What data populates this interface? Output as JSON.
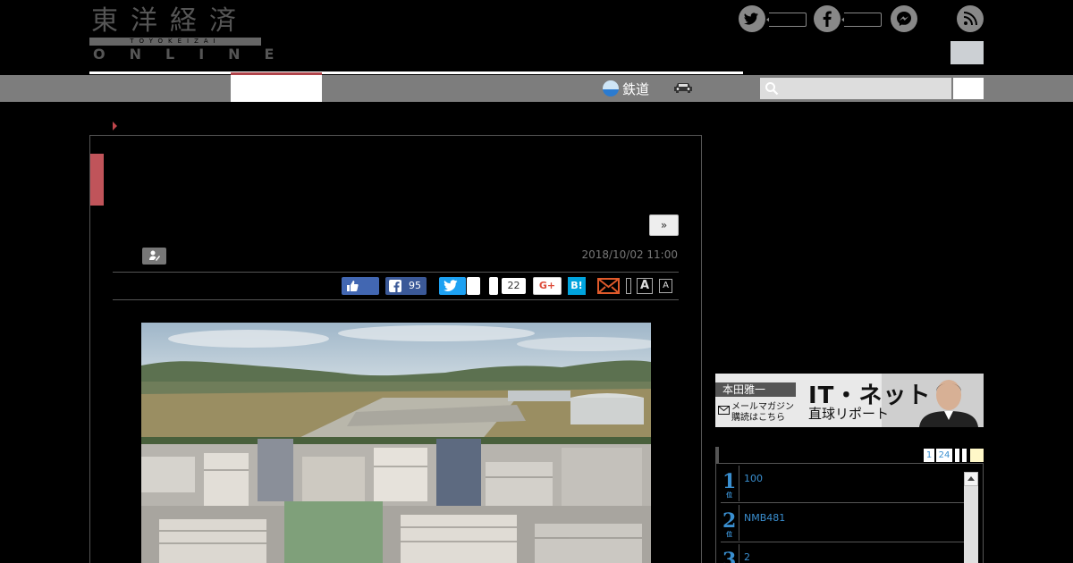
{
  "header": {
    "logo_kanji": "東洋経済",
    "logo_band": "TOYOKEIZAI",
    "logo_online": "ONLINE"
  },
  "nav": {
    "rail_label": "鉄道"
  },
  "search": {
    "placeholder": ""
  },
  "article": {
    "next_label": "»",
    "date": "2018/10/02 11:00"
  },
  "share": {
    "facebook_count": "95",
    "pocket_count": "22",
    "gplus_label": "G+",
    "hatena_label": "B!",
    "font_large_label": "A",
    "font_small_label": "A"
  },
  "banner": {
    "author": "本田雅一",
    "title": "IT・ネット",
    "subtitle": "直球リポート",
    "mail_line1": "メールマガジン",
    "mail_line2": "購読はこちら"
  },
  "ranking": {
    "tabs": [
      "1",
      "24"
    ],
    "items": [
      {
        "rank": "1",
        "suffix": "位",
        "text": "100"
      },
      {
        "rank": "2",
        "suffix": "位",
        "text": "NMB481"
      },
      {
        "rank": "3",
        "suffix": "位",
        "text": "2"
      }
    ]
  },
  "colors": {
    "accent": "#c0545a",
    "nav_bg": "#7d7d7d",
    "link": "#3a8fd0"
  }
}
